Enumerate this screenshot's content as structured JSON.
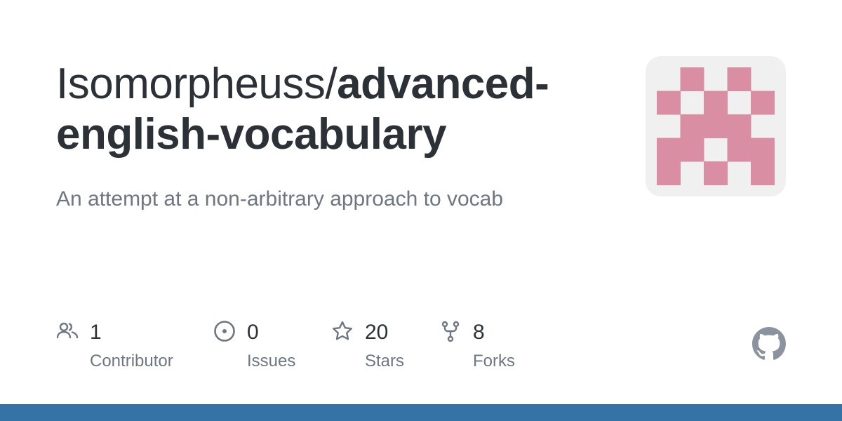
{
  "header": {
    "owner": "Isomorpheuss/",
    "repo": "advanced-english-vocabulary"
  },
  "description": "An attempt at a non-arbitrary approach to vocab",
  "avatar": {
    "icon": "identicon",
    "color": "#d98ea3",
    "background": "#f0f0f0"
  },
  "stats": [
    {
      "icon": "people-icon",
      "count": "1",
      "label": "Contributor"
    },
    {
      "icon": "issue-opened-icon",
      "count": "0",
      "label": "Issues"
    },
    {
      "icon": "star-icon",
      "count": "20",
      "label": "Stars"
    },
    {
      "icon": "repo-forked-icon",
      "count": "8",
      "label": "Forks"
    }
  ],
  "logo": {
    "icon": "github-mark-icon",
    "color": "#8b949e"
  },
  "colors": {
    "accent_bar": "#3572a5",
    "text_primary": "#2b3137",
    "text_secondary": "#6e7781",
    "icon": "#6e7781"
  }
}
